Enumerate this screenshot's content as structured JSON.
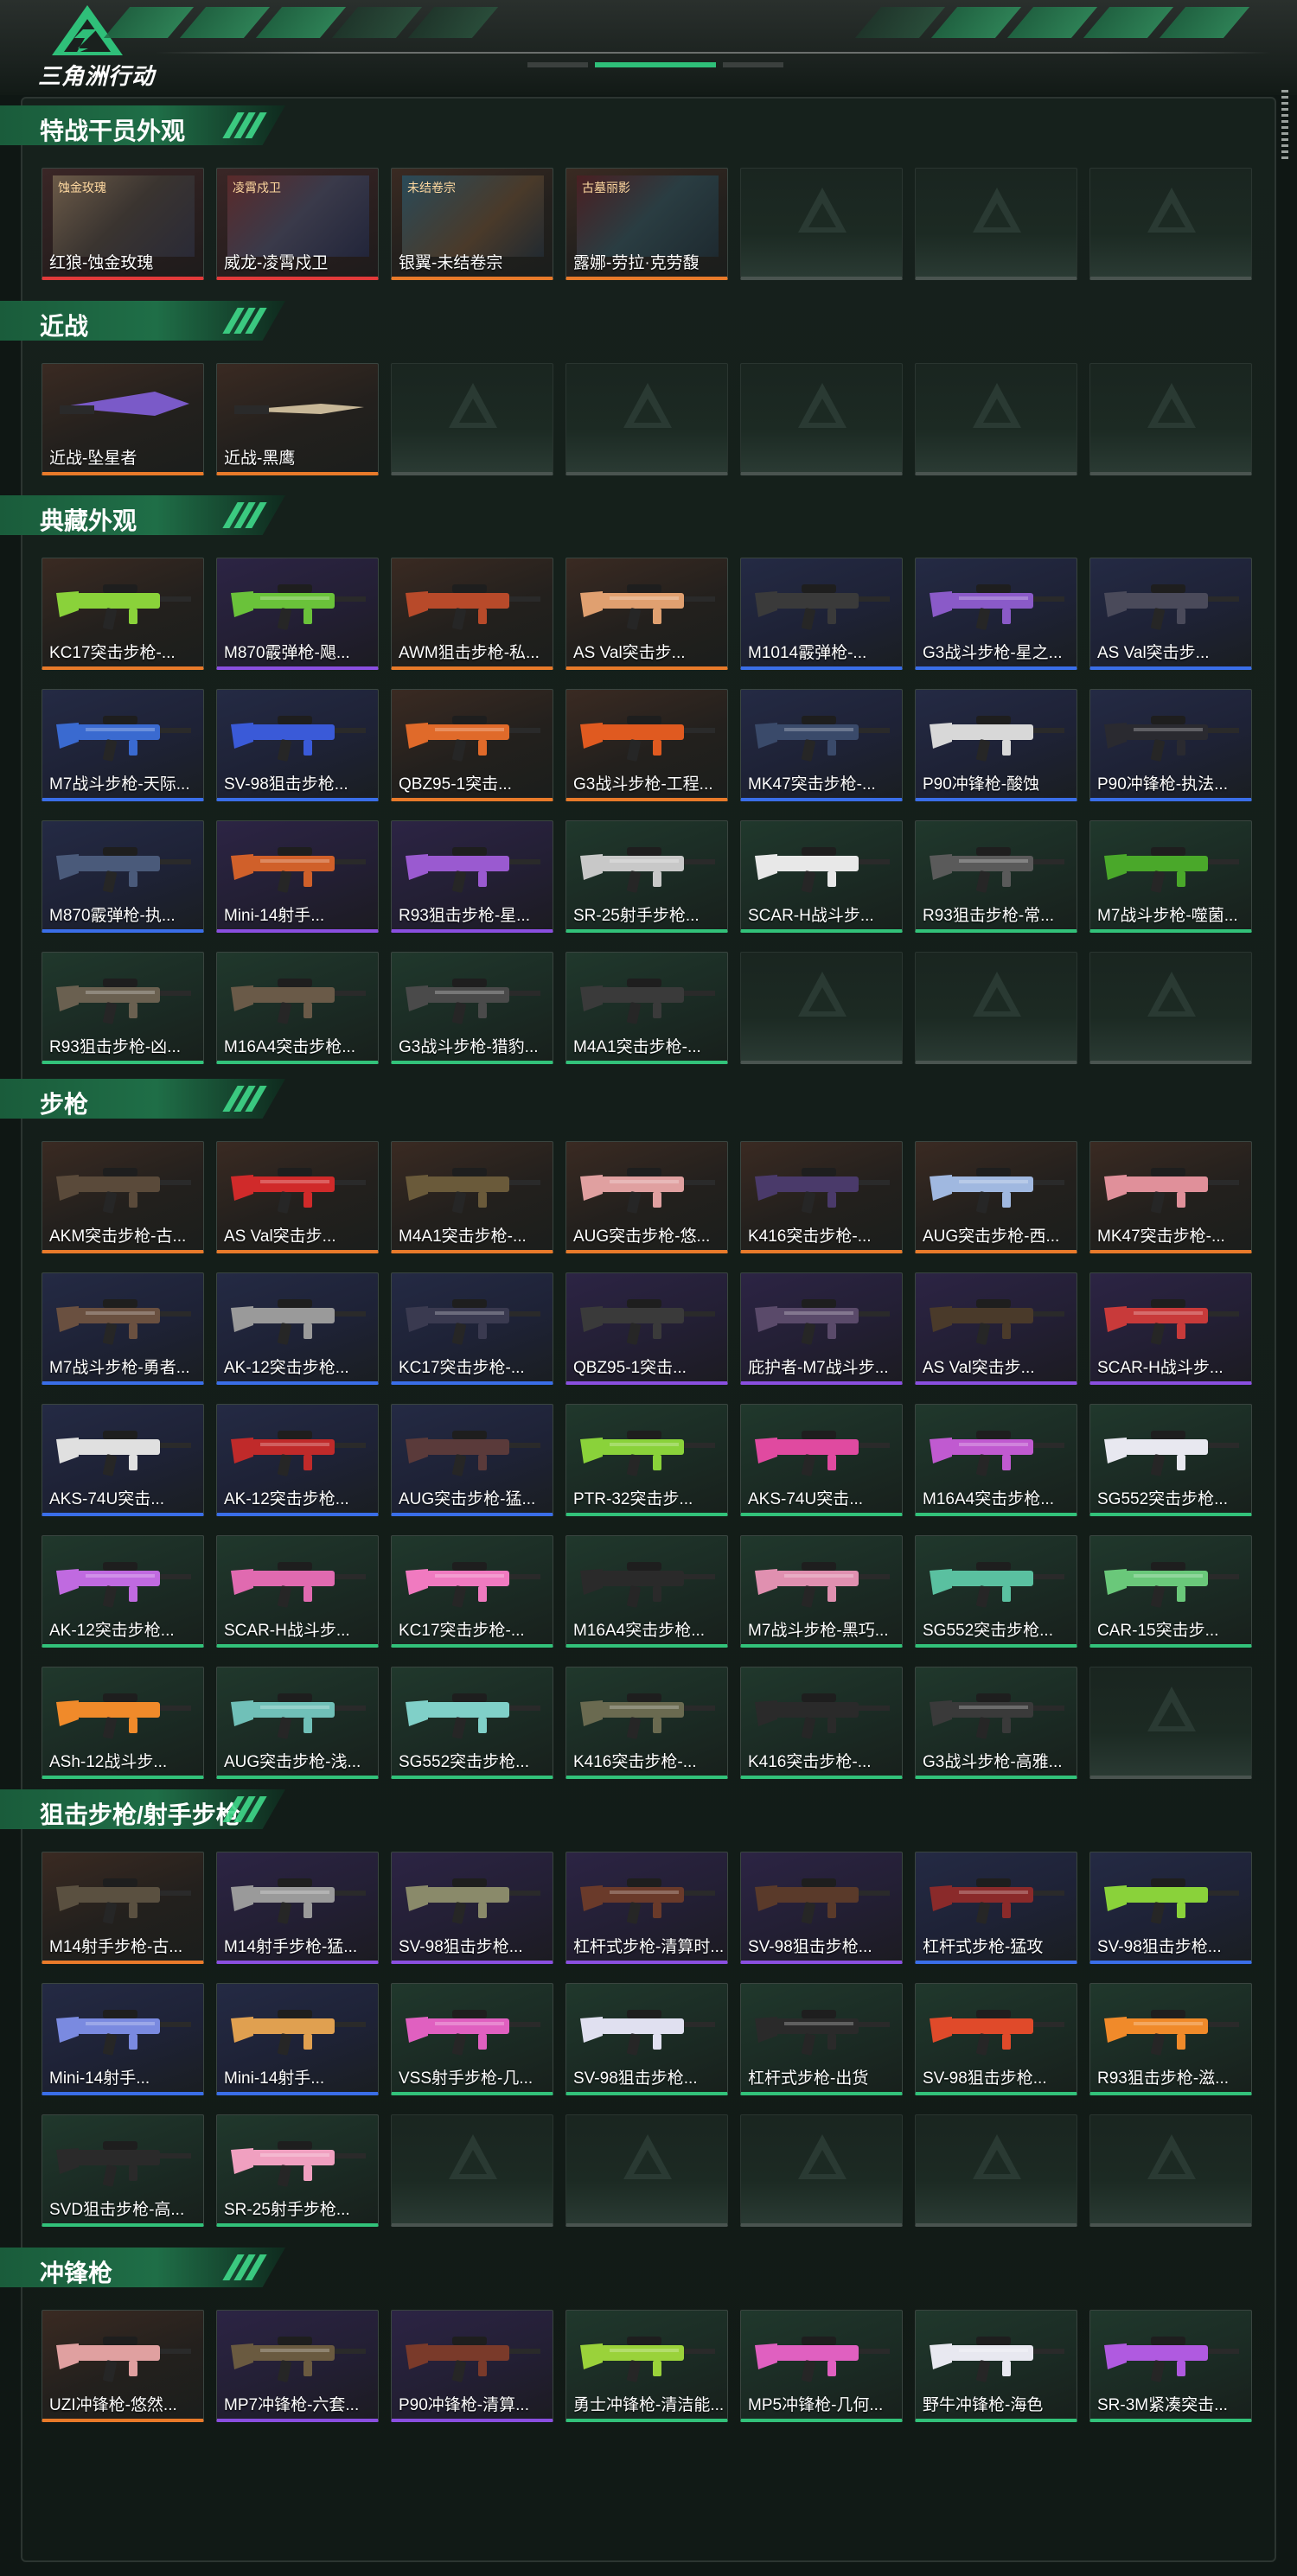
{
  "app": {
    "logo_text": "三角洲行动"
  },
  "colors": {
    "orange": "#e87a2a",
    "blue": "#3a6ee8",
    "purple": "#8a4fe0",
    "green": "#32c27a",
    "red": "#e23a3a"
  },
  "sections": [
    {
      "title": "特战干员外观",
      "items": [
        {
          "name": "红狼-蚀金玫瑰",
          "rarity": "red",
          "tag": "蚀金玫瑰"
        },
        {
          "name": "威龙-凌霄戍卫",
          "rarity": "red",
          "tag": "凌霄戍卫"
        },
        {
          "name": "银翼-未结卷宗",
          "rarity": "orange",
          "tag": "未结卷宗"
        },
        {
          "name": "露娜-劳拉·克劳馥",
          "rarity": "orange",
          "tag": "古墓丽影"
        },
        {
          "name": "",
          "rarity": "empty"
        },
        {
          "name": "",
          "rarity": "empty"
        },
        {
          "name": "",
          "rarity": "empty"
        }
      ]
    },
    {
      "title": "近战",
      "items": [
        {
          "name": "近战-坠星者",
          "rarity": "orange",
          "icon": "knife-icon"
        },
        {
          "name": "近战-黑鹰",
          "rarity": "orange",
          "icon": "knife-icon"
        },
        {
          "name": "",
          "rarity": "empty"
        },
        {
          "name": "",
          "rarity": "empty"
        },
        {
          "name": "",
          "rarity": "empty"
        },
        {
          "name": "",
          "rarity": "empty"
        },
        {
          "name": "",
          "rarity": "empty"
        }
      ]
    },
    {
      "title": "典藏外观",
      "items": [
        {
          "name": "KC17突击步枪-...",
          "rarity": "orange",
          "color": "#8ad23a"
        },
        {
          "name": "M870霰弹枪-飓...",
          "rarity": "purple",
          "color": "#6ac23a"
        },
        {
          "name": "AWM狙击步枪-私...",
          "rarity": "orange",
          "color": "#b84a2a"
        },
        {
          "name": "AS Val突击步...",
          "rarity": "orange",
          "color": "#e0a070"
        },
        {
          "name": "M1014霰弹枪-...",
          "rarity": "blue",
          "color": "#3a3a3a"
        },
        {
          "name": "G3战斗步枪-星之...",
          "rarity": "blue",
          "color": "#8a5ac8"
        },
        {
          "name": "AS Val突击步...",
          "rarity": "blue",
          "color": "#4a4a5a"
        },
        {
          "name": "M7战斗步枪-天际...",
          "rarity": "blue",
          "color": "#3a6ad0"
        },
        {
          "name": "SV-98狙击步枪...",
          "rarity": "blue",
          "color": "#3a5ad8"
        },
        {
          "name": "QBZ95-1突击...",
          "rarity": "orange",
          "color": "#e06a2a"
        },
        {
          "name": "G3战斗步枪-工程...",
          "rarity": "orange",
          "color": "#e05a20"
        },
        {
          "name": "MK47突击步枪-...",
          "rarity": "blue",
          "color": "#3a4a6a"
        },
        {
          "name": "P90冲锋枪-酸蚀",
          "rarity": "blue",
          "color": "#d8d8d8"
        },
        {
          "name": "P90冲锋枪-执法...",
          "rarity": "blue",
          "color": "#2a2a30"
        },
        {
          "name": "M870霰弹枪-执...",
          "rarity": "blue",
          "color": "#4a5a7a"
        },
        {
          "name": "Mini-14射手...",
          "rarity": "purple",
          "color": "#d0602a"
        },
        {
          "name": "R93狙击步枪-星...",
          "rarity": "purple",
          "color": "#9a5ad0"
        },
        {
          "name": "SR-25射手步枪...",
          "rarity": "green",
          "color": "#c8c8c8"
        },
        {
          "name": "SCAR-H战斗步...",
          "rarity": "green",
          "color": "#e8e8e8"
        },
        {
          "name": "R93狙击步枪-常...",
          "rarity": "green",
          "color": "#5a5a5a"
        },
        {
          "name": "M7战斗步枪-噬菌...",
          "rarity": "green",
          "color": "#4aa82a"
        },
        {
          "name": "R93狙击步枪-凶...",
          "rarity": "green",
          "color": "#6a6050"
        },
        {
          "name": "M16A4突击步枪...",
          "rarity": "green",
          "color": "#6a5a48"
        },
        {
          "name": "G3战斗步枪-猎豹...",
          "rarity": "green",
          "color": "#4a4a4a"
        },
        {
          "name": "M4A1突击步枪-...",
          "rarity": "green",
          "color": "#3a3a3a"
        },
        {
          "name": "",
          "rarity": "empty"
        },
        {
          "name": "",
          "rarity": "empty"
        },
        {
          "name": "",
          "rarity": "empty"
        }
      ]
    },
    {
      "title": "步枪",
      "items": [
        {
          "name": "AKM突击步枪-古...",
          "rarity": "orange",
          "color": "#5a4a3a"
        },
        {
          "name": "AS Val突击步...",
          "rarity": "orange",
          "color": "#d02a2a"
        },
        {
          "name": "M4A1突击步枪-...",
          "rarity": "orange",
          "color": "#6a5a3a"
        },
        {
          "name": "AUG突击步枪-悠...",
          "rarity": "orange",
          "color": "#e0a0a0"
        },
        {
          "name": "K416突击步枪-...",
          "rarity": "orange",
          "color": "#4a3a6a"
        },
        {
          "name": "AUG突击步枪-西...",
          "rarity": "orange",
          "color": "#a0b8e0"
        },
        {
          "name": "MK47突击步枪-...",
          "rarity": "orange",
          "color": "#e0909a"
        },
        {
          "name": "M7战斗步枪-勇者...",
          "rarity": "blue",
          "color": "#6a5040"
        },
        {
          "name": "AK-12突击步枪...",
          "rarity": "blue",
          "color": "#9a9a9a"
        },
        {
          "name": "KC17突击步枪-...",
          "rarity": "blue",
          "color": "#3a3a50"
        },
        {
          "name": "QBZ95-1突击...",
          "rarity": "purple",
          "color": "#3a3a3a"
        },
        {
          "name": "庇护者-M7战斗步...",
          "rarity": "purple",
          "color": "#5a4a6a"
        },
        {
          "name": "AS Val突击步...",
          "rarity": "purple",
          "color": "#4a3a2a"
        },
        {
          "name": "SCAR-H战斗步...",
          "rarity": "purple",
          "color": "#c83a3a"
        },
        {
          "name": "AKS-74U突击...",
          "rarity": "blue",
          "color": "#e0e0e0"
        },
        {
          "name": "AK-12突击步枪...",
          "rarity": "blue",
          "color": "#c02a2a"
        },
        {
          "name": "AUG突击步枪-猛...",
          "rarity": "blue",
          "color": "#5a3a3a"
        },
        {
          "name": "PTR-32突击步...",
          "rarity": "green",
          "color": "#8ad23a"
        },
        {
          "name": "AKS-74U突击...",
          "rarity": "green",
          "color": "#e04aa0"
        },
        {
          "name": "M16A4突击步枪...",
          "rarity": "green",
          "color": "#c05ad0"
        },
        {
          "name": "SG552突击步枪...",
          "rarity": "green",
          "color": "#e8e8f0"
        },
        {
          "name": "AK-12突击步枪...",
          "rarity": "green",
          "color": "#c06ae0"
        },
        {
          "name": "SCAR-H战斗步...",
          "rarity": "green",
          "color": "#e06ab0"
        },
        {
          "name": "KC17突击步枪-...",
          "rarity": "green",
          "color": "#f07ac0"
        },
        {
          "name": "M16A4突击步枪...",
          "rarity": "green",
          "color": "#2a2a2a"
        },
        {
          "name": "M7战斗步枪-黑巧...",
          "rarity": "green",
          "color": "#e090b0"
        },
        {
          "name": "SG552突击步枪...",
          "rarity": "green",
          "color": "#5ac0a0"
        },
        {
          "name": "CAR-15突击步...",
          "rarity": "green",
          "color": "#6ac87a"
        },
        {
          "name": "ASh-12战斗步...",
          "rarity": "green",
          "color": "#f08a2a"
        },
        {
          "name": "AUG突击步枪-浅...",
          "rarity": "green",
          "color": "#70c0b8"
        },
        {
          "name": "SG552突击步枪...",
          "rarity": "green",
          "color": "#80d0c8"
        },
        {
          "name": "K416突击步枪-...",
          "rarity": "green",
          "color": "#6a6a50"
        },
        {
          "name": "K416突击步枪-...",
          "rarity": "green",
          "color": "#2a2a2a"
        },
        {
          "name": "G3战斗步枪-高雅...",
          "rarity": "green",
          "color": "#3a3a3a"
        },
        {
          "name": "",
          "rarity": "empty"
        }
      ]
    },
    {
      "title": "狙击步枪/射手步枪",
      "items": [
        {
          "name": "M14射手步枪-古...",
          "rarity": "orange",
          "color": "#5a5040"
        },
        {
          "name": "M14射手步枪-猛...",
          "rarity": "purple",
          "color": "#9a9a9a"
        },
        {
          "name": "SV-98狙击步枪...",
          "rarity": "purple",
          "color": "#8a8a6a"
        },
        {
          "name": "杠杆式步枪-清算时...",
          "rarity": "purple",
          "color": "#6a3a2a"
        },
        {
          "name": "SV-98狙击步枪...",
          "rarity": "purple",
          "color": "#5a3a2a"
        },
        {
          "name": "杠杆式步枪-猛攻",
          "rarity": "blue",
          "color": "#8a2a2a"
        },
        {
          "name": "SV-98狙击步枪...",
          "rarity": "blue",
          "color": "#8ad23a"
        },
        {
          "name": "Mini-14射手...",
          "rarity": "blue",
          "color": "#7a8ae0"
        },
        {
          "name": "Mini-14射手...",
          "rarity": "blue",
          "color": "#e0a050"
        },
        {
          "name": "VSS射手步枪-几...",
          "rarity": "green",
          "color": "#e060c0"
        },
        {
          "name": "SV-98狙击步枪...",
          "rarity": "green",
          "color": "#e0e0f0"
        },
        {
          "name": "杠杆式步枪-出货",
          "rarity": "green",
          "color": "#2a2a2a"
        },
        {
          "name": "SV-98狙击步枪...",
          "rarity": "green",
          "color": "#e04a2a"
        },
        {
          "name": "R93狙击步枪-滋...",
          "rarity": "green",
          "color": "#f08a2a"
        },
        {
          "name": "SVD狙击步枪-高...",
          "rarity": "green",
          "color": "#2a2a2a"
        },
        {
          "name": "SR-25射手步枪...",
          "rarity": "green",
          "color": "#f0a0c0"
        },
        {
          "name": "",
          "rarity": "empty"
        },
        {
          "name": "",
          "rarity": "empty"
        },
        {
          "name": "",
          "rarity": "empty"
        },
        {
          "name": "",
          "rarity": "empty"
        },
        {
          "name": "",
          "rarity": "empty"
        }
      ]
    },
    {
      "title": "冲锋枪",
      "items": [
        {
          "name": "UZI冲锋枪-悠然...",
          "rarity": "orange",
          "color": "#e0a0a0"
        },
        {
          "name": "MP7冲锋枪-六套...",
          "rarity": "purple",
          "color": "#6a5a40"
        },
        {
          "name": "P90冲锋枪-清算...",
          "rarity": "purple",
          "color": "#7a3a2a"
        },
        {
          "name": "勇士冲锋枪-清洁能...",
          "rarity": "green",
          "color": "#9ad23a"
        },
        {
          "name": "MP5冲锋枪-几何...",
          "rarity": "green",
          "color": "#e060c0"
        },
        {
          "name": "野牛冲锋枪-海色",
          "rarity": "green",
          "color": "#e8e8f0"
        },
        {
          "name": "SR-3M紧凑突击...",
          "rarity": "green",
          "color": "#b05ae0"
        }
      ]
    }
  ]
}
